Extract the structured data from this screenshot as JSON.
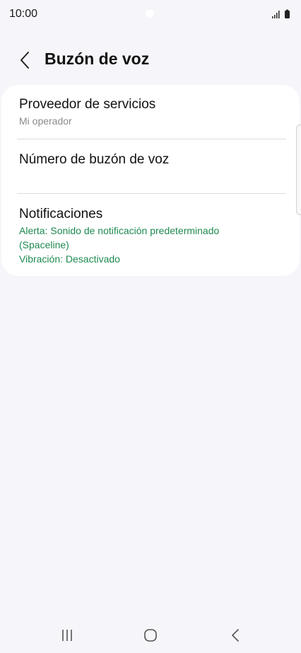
{
  "status_bar": {
    "time": "10:00",
    "icons": [
      "signal-icon",
      "battery-icon"
    ]
  },
  "header": {
    "back_icon": "chevron-left-icon",
    "title": "Buzón de voz"
  },
  "settings": {
    "items": [
      {
        "title": "Proveedor de servicios",
        "subtitle": "Mi operador"
      },
      {
        "title": "Número de buzón de voz"
      },
      {
        "title": "Notificaciones",
        "details_line1": "Alerta: Sonido de notificación predeterminado",
        "details_line2": "(Spaceline)",
        "details_line3": "Vibración: Desactivado"
      }
    ]
  },
  "navigation_bar": {
    "buttons": [
      "recent-apps-icon",
      "home-icon",
      "back-icon"
    ]
  },
  "colors": {
    "background": "#f6f5f9",
    "card": "#ffffff",
    "accent_green": "#1e8a50",
    "secondary_text": "#8a8a8a"
  }
}
